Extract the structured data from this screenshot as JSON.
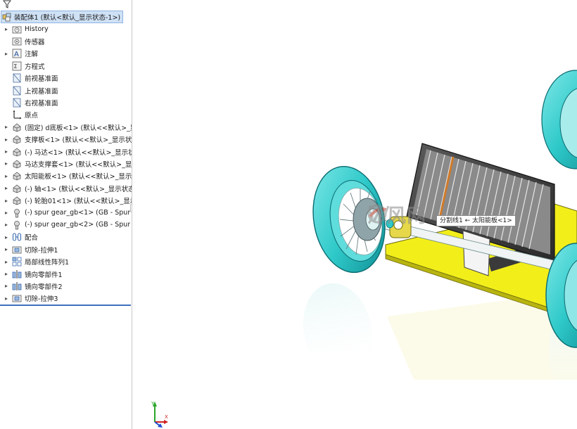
{
  "tree": {
    "root_label": "装配体1  (默认<默认_显示状态-1>)",
    "items": [
      {
        "label": "History",
        "icon": "history-folder-icon",
        "expandable": true
      },
      {
        "label": "传感器",
        "icon": "sensor-folder-icon",
        "expandable": false
      },
      {
        "label": "注解",
        "icon": "annotations-icon",
        "expandable": true
      },
      {
        "label": "方程式",
        "icon": "equations-icon",
        "expandable": false
      },
      {
        "label": "前视基准面",
        "icon": "plane-icon",
        "expandable": false
      },
      {
        "label": "上视基准面",
        "icon": "plane-icon",
        "expandable": false
      },
      {
        "label": "右视基准面",
        "icon": "plane-icon",
        "expandable": false
      },
      {
        "label": "原点",
        "icon": "origin-icon",
        "expandable": false
      },
      {
        "label": "(固定) d底板<1> (默认<<默认>_显",
        "icon": "part-icon",
        "expandable": true
      },
      {
        "label": "支撑板<1> (默认<<默认>_显示状",
        "icon": "part-icon",
        "expandable": true
      },
      {
        "label": "(-) 马达<1> (默认<<默认>_显示状",
        "icon": "part-icon",
        "expandable": true
      },
      {
        "label": "马达支撑套<1> (默认<<默认>_显",
        "icon": "part-icon",
        "expandable": true
      },
      {
        "label": "太阳能板<1> (默认<<默认>_显示:",
        "icon": "part-icon",
        "expandable": true
      },
      {
        "label": "(-) 轴<1> (默认<<默认>_显示状态",
        "icon": "part-icon",
        "expandable": true
      },
      {
        "label": "(-) 轮胎01<1> (默认<<默认>_显示",
        "icon": "part-icon",
        "expandable": true
      },
      {
        "label": "(-) spur gear_gb<1> (GB - Spur",
        "icon": "toolbox-part-icon",
        "expandable": true
      },
      {
        "label": "(-) spur gear_gb<2> (GB - Spur",
        "icon": "toolbox-part-icon",
        "expandable": true
      },
      {
        "label": "配合",
        "icon": "mates-icon",
        "expandable": true
      },
      {
        "label": "切除-拉伸1",
        "icon": "cut-extrude-icon",
        "expandable": true
      },
      {
        "label": "局部线性阵列1",
        "icon": "linear-pattern-icon",
        "expandable": true
      },
      {
        "label": "镜向零部件1",
        "icon": "mirror-component-icon",
        "expandable": true
      },
      {
        "label": "镜向零部件2",
        "icon": "mirror-component-icon",
        "expandable": true
      },
      {
        "label": "切除-拉伸3",
        "icon": "cut-extrude-icon",
        "expandable": true
      }
    ]
  },
  "viewport": {
    "tooltip": "分割线1 ← 太阳能板<1>",
    "watermark": "沐风网",
    "triad_icon": "xyz-triad-icon",
    "colors": {
      "wheel_cyan": "#2fc9c9",
      "base_plate_yellow": "#f2ee1a",
      "solar_panel_dark": "#3a3a3a",
      "root_highlight": "#cfe1f5"
    }
  }
}
